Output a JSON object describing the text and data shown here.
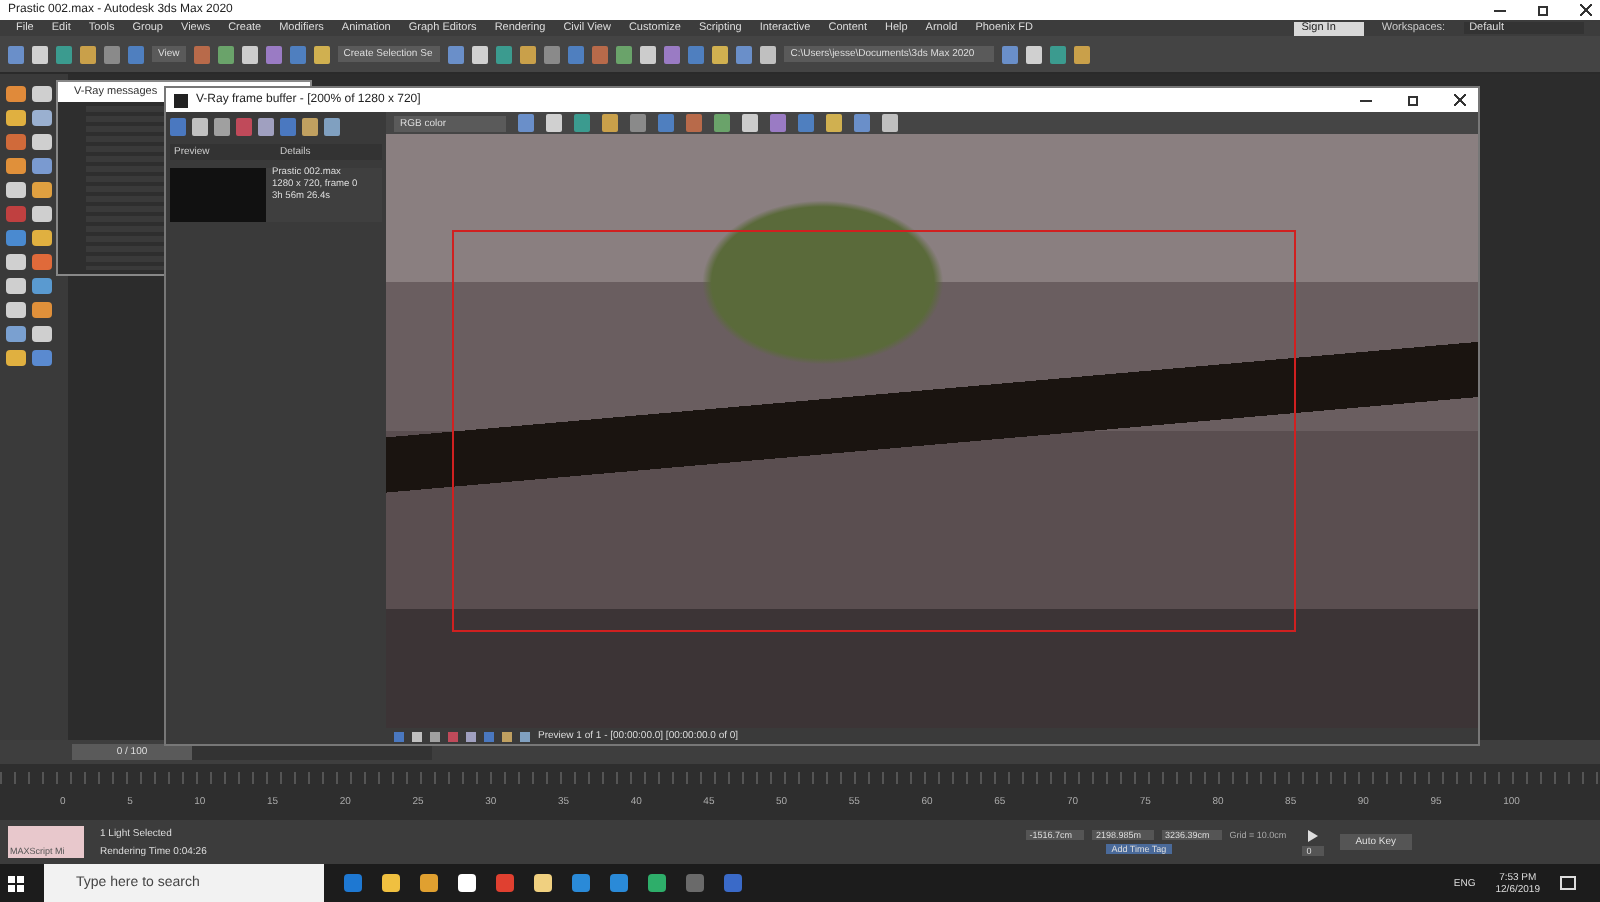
{
  "window": {
    "title": "Prastic 002.max - Autodesk 3ds Max 2020"
  },
  "menu": [
    "File",
    "Edit",
    "Tools",
    "Group",
    "Views",
    "Create",
    "Modifiers",
    "Animation",
    "Graph Editors",
    "Rendering",
    "Civil View",
    "Customize",
    "Scripting",
    "Interactive",
    "Content",
    "Help",
    "Arnold",
    "Phoenix FD"
  ],
  "toolbar": {
    "view": "View",
    "selection_set": "Create Selection Se",
    "path": "C:\\Users\\jesse\\Documents\\3ds Max 2020",
    "sign_in": "Sign In",
    "workspaces_label": "Workspaces:",
    "workspace": "Default"
  },
  "vray_messages": {
    "title": "V-Ray messages"
  },
  "frame_buffer": {
    "title": "V-Ray frame buffer - [200% of 1280 x 720]",
    "channel": "RGB color",
    "history_columns": [
      "Preview",
      "Details"
    ],
    "history_details": [
      "Prastic 002.max",
      "1280 x 720, frame 0",
      "3h 56m 26.4s"
    ],
    "status": "Preview 1 of 1 - [00:00:00.0] [00:00:00.0 of 0]"
  },
  "time_slider": {
    "label": "0 / 100",
    "level": 0
  },
  "timeline": {
    "ticks": [
      "0",
      "5",
      "10",
      "15",
      "20",
      "25",
      "30",
      "35",
      "40",
      "45",
      "50",
      "55",
      "60",
      "65",
      "70",
      "75",
      "80",
      "85",
      "90",
      "95",
      "100"
    ]
  },
  "status_bar": {
    "maxscript": "MAXScript Mi",
    "selection": "1 Light Selected",
    "render_time": "Rendering Time 0:04:26",
    "x": "-1516.7cm",
    "y": "2198.985m",
    "z": "3236.39cm",
    "grid": "Grid = 10.0cm",
    "add_time_tag": "Add Time Tag",
    "auto_key": "Auto Key",
    "frame": "0"
  },
  "taskbar": {
    "search_placeholder": "Type here to search",
    "language": "ENG",
    "time": "7:53 PM",
    "date": "12/6/2019"
  }
}
